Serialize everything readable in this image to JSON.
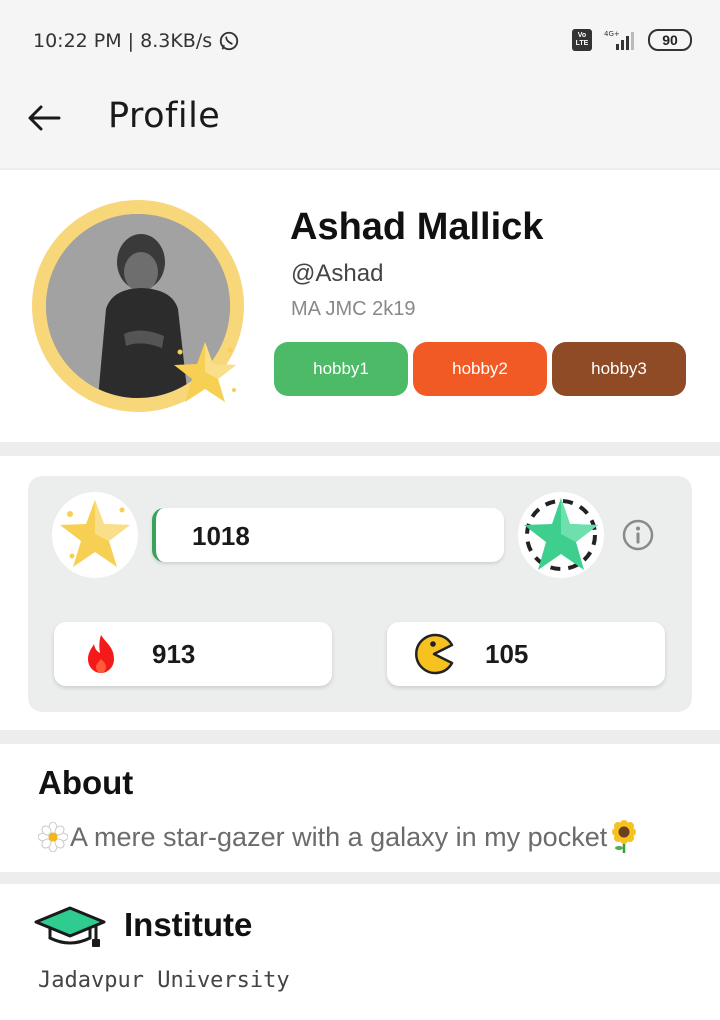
{
  "status_bar": {
    "time_speed": "10:22 PM | 8.3KB/s",
    "network": "4G+",
    "battery": "90",
    "icons": [
      "whatsapp-icon",
      "volte-icon",
      "signal-icon",
      "battery-icon"
    ]
  },
  "app_bar": {
    "title": "Profile",
    "back_icon": "arrow-left-icon"
  },
  "profile": {
    "name": "Ashad Mallick",
    "handle": "@Ashad",
    "course": "MA JMC 2k19",
    "hobbies": [
      {
        "label": "hobby1",
        "color": "#4cba66"
      },
      {
        "label": "hobby2",
        "color": "#f25a25"
      },
      {
        "label": "hobby3",
        "color": "#8f4a26"
      }
    ]
  },
  "stats": {
    "points": "1018",
    "streak": "913",
    "games": "105",
    "accent": "#3aa35a"
  },
  "about": {
    "title": "About",
    "bio": "A mere star-gazer with a galaxy in my pocket"
  },
  "institute": {
    "title": "Institute",
    "name": "Jadavpur University"
  }
}
